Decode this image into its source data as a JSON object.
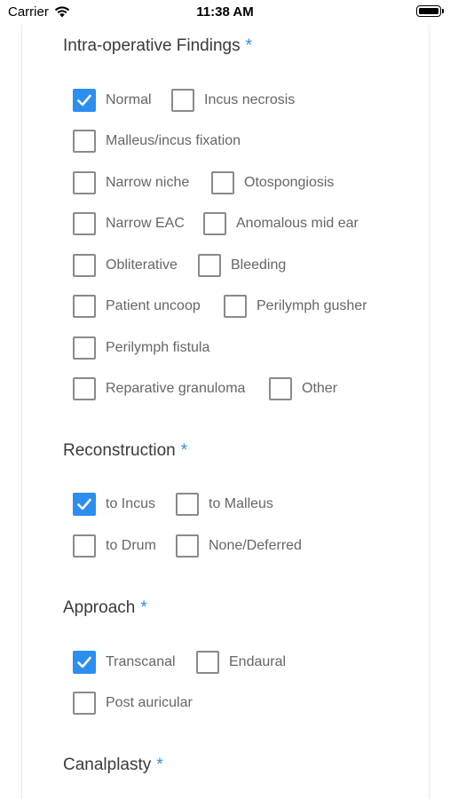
{
  "status_bar": {
    "carrier": "Carrier",
    "time": "11:38 AM"
  },
  "required_marker": "*",
  "sections": {
    "findings": {
      "title": "Intra-operative Findings",
      "options": [
        {
          "label": "Normal",
          "checked": true
        },
        {
          "label": "Incus necrosis",
          "checked": false
        },
        {
          "label": "Malleus/incus fixation",
          "checked": false
        },
        {
          "label": "Narrow niche",
          "checked": false
        },
        {
          "label": "Otospongiosis",
          "checked": false
        },
        {
          "label": "Narrow EAC",
          "checked": false
        },
        {
          "label": "Anomalous mid ear",
          "checked": false
        },
        {
          "label": "Obliterative",
          "checked": false
        },
        {
          "label": "Bleeding",
          "checked": false
        },
        {
          "label": "Patient uncoop",
          "checked": false
        },
        {
          "label": "Perilymph gusher",
          "checked": false
        },
        {
          "label": "Perilymph fistula",
          "checked": false
        },
        {
          "label": "Reparative granuloma",
          "checked": false
        },
        {
          "label": "Other",
          "checked": false
        }
      ]
    },
    "reconstruction": {
      "title": "Reconstruction",
      "options": [
        {
          "label": "to Incus",
          "checked": true
        },
        {
          "label": "to Malleus",
          "checked": false
        },
        {
          "label": "to Drum",
          "checked": false
        },
        {
          "label": "None/Deferred",
          "checked": false
        }
      ]
    },
    "approach": {
      "title": "Approach",
      "options": [
        {
          "label": "Transcanal",
          "checked": true
        },
        {
          "label": "Endaural",
          "checked": false
        },
        {
          "label": "Post auricular",
          "checked": false
        }
      ]
    },
    "canalplasty": {
      "title": "Canalplasty"
    }
  },
  "colors": {
    "accent": "#2b8ff0",
    "checkbox_border": "#8a8a8a",
    "label": "#666666",
    "title": "#3a3a3a"
  }
}
